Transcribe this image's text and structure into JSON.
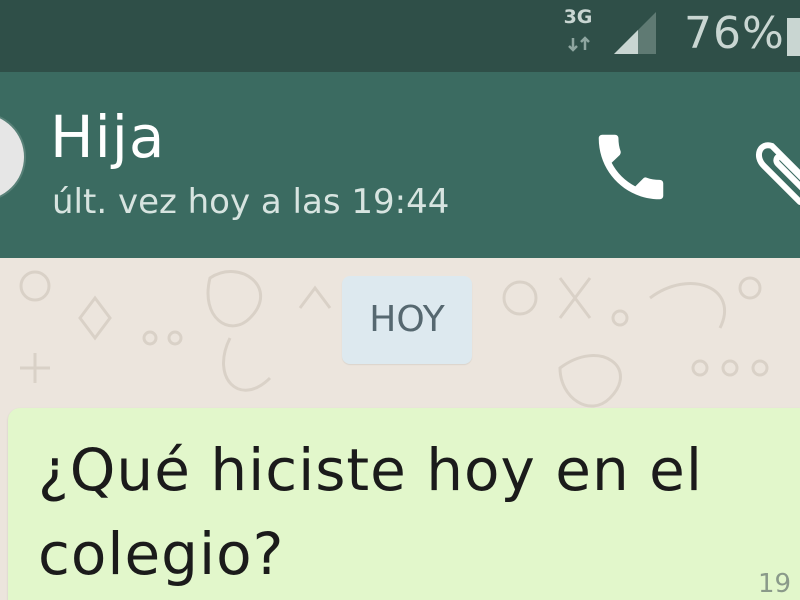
{
  "status_bar": {
    "network_type": "3G",
    "network_activity_icon": "data-arrows-icon",
    "signal_icon": "signal-strength-icon",
    "battery_percent": "76%",
    "battery_icon": "battery-icon"
  },
  "header": {
    "contact_name": "Hija",
    "last_seen": "últ. vez hoy a las 19:44",
    "avatar_icon": "avatar",
    "call_icon": "phone-icon",
    "attach_icon": "paperclip-icon"
  },
  "chat": {
    "date_divider": "HOY",
    "messages": [
      {
        "text": "¿Qué hiciste hoy en el colegio?",
        "time": "19"
      }
    ]
  },
  "colors": {
    "status_bar": "#2f4f48",
    "app_bar": "#3b6b61",
    "chat_background": "#ece5dd",
    "outgoing_bubble": "#e2f7cb",
    "date_chip": "#dde9ef"
  }
}
